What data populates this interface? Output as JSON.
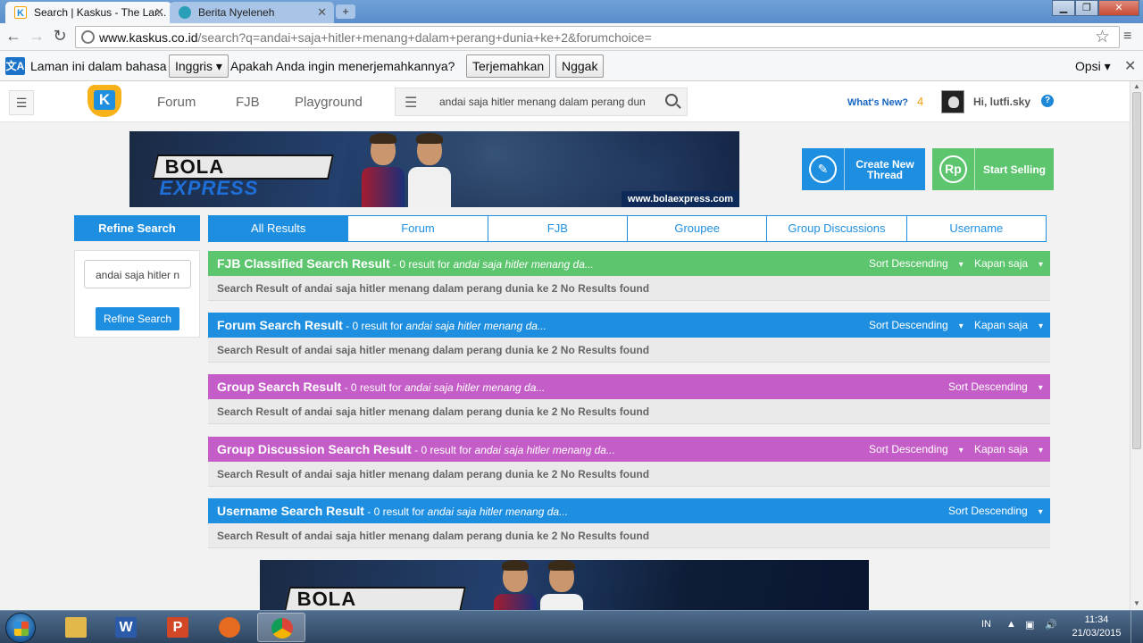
{
  "browser": {
    "tabs": [
      {
        "label": "Search | Kaskus - The Lar...",
        "favicon": "K",
        "active": true
      },
      {
        "label": "Berita Nyeleneh",
        "active": false
      }
    ],
    "url_host": "www.kaskus.co.id",
    "url_path": "/search?q=andai+saja+hitler+menang+dalam+perang+dunia+ke+2&forumchoice="
  },
  "translate_bar": {
    "prompt": "Laman ini dalam bahasa",
    "language": "Inggris",
    "question": "Apakah Anda ingin menerjemahkannya?",
    "translate_label": "Terjemahkan",
    "decline_label": "Nggak",
    "options_label": "Opsi"
  },
  "header": {
    "nav": [
      "Forum",
      "FJB",
      "Playground"
    ],
    "search_query": "andai saja hitler menang dalam perang dun",
    "whats_new": "What's New?",
    "notif_count": "4",
    "greeting": "Hi, lutfi.sky",
    "help": "?"
  },
  "banner": {
    "brand_a": "BOLA",
    "brand_b": "EXPRESS",
    "url": "www.bolaexpress.com"
  },
  "actions": {
    "create_thread": "Create New Thread",
    "start_selling": "Start Selling",
    "rp_symbol": "Rp",
    "pencil_symbol": "✎"
  },
  "refine": {
    "heading": "Refine Search",
    "input_value": "andai saja hitler n",
    "button": "Refine Search"
  },
  "tabs": [
    "All Results",
    "Forum",
    "FJB",
    "Groupee",
    "Group Discussions",
    "Username"
  ],
  "sections": [
    {
      "title": "FJB Classified Search Result",
      "count": " - 0 result for ",
      "query": "andai saja hitler menang da...",
      "sort": "Sort Descending",
      "time": "Kapan saja",
      "color": "#5cc56d",
      "result": "Search Result of andai saja hitler menang dalam perang dunia ke 2 No Results found"
    },
    {
      "title": "Forum Search Result",
      "count": " - 0 result for ",
      "query": "andai saja hitler menang da...",
      "sort": "Sort Descending",
      "time": "Kapan saja",
      "color": "#1e8fe0",
      "result": "Search Result of andai saja hitler menang dalam perang dunia ke 2 No Results found"
    },
    {
      "title": "Group Search Result",
      "count": " - 0 result for ",
      "query": "andai saja hitler menang da...",
      "sort": "Sort Descending",
      "time": "",
      "color": "#c45dc8",
      "result": "Search Result of andai saja hitler menang dalam perang dunia ke 2 No Results found"
    },
    {
      "title": "Group Discussion Search Result",
      "count": " - 0 result for ",
      "query": "andai saja hitler menang da...",
      "sort": "Sort Descending",
      "time": "Kapan saja",
      "color": "#c45dc8",
      "result": "Search Result of andai saja hitler menang dalam perang dunia ke 2 No Results found"
    },
    {
      "title": "Username Search Result",
      "count": " - 0 result for ",
      "query": "andai saja hitler menang da...",
      "sort": "Sort Descending",
      "time": "",
      "color": "#1e8fe0",
      "result": "Search Result of andai saja hitler menang dalam perang dunia ke 2 No Results found"
    }
  ],
  "taskbar": {
    "apps": [
      {
        "name": "explorer",
        "glyph": "",
        "color": "#e3b84a"
      },
      {
        "name": "word",
        "glyph": "W",
        "color": "#2b5aa8"
      },
      {
        "name": "powerpoint",
        "glyph": "P",
        "color": "#d24726"
      },
      {
        "name": "firefox",
        "glyph": "",
        "color": "#e66a1f"
      },
      {
        "name": "chrome",
        "glyph": "",
        "color": "#3a8ed8"
      }
    ],
    "lang": "IN",
    "time": "11:34",
    "date": "21/03/2015"
  }
}
